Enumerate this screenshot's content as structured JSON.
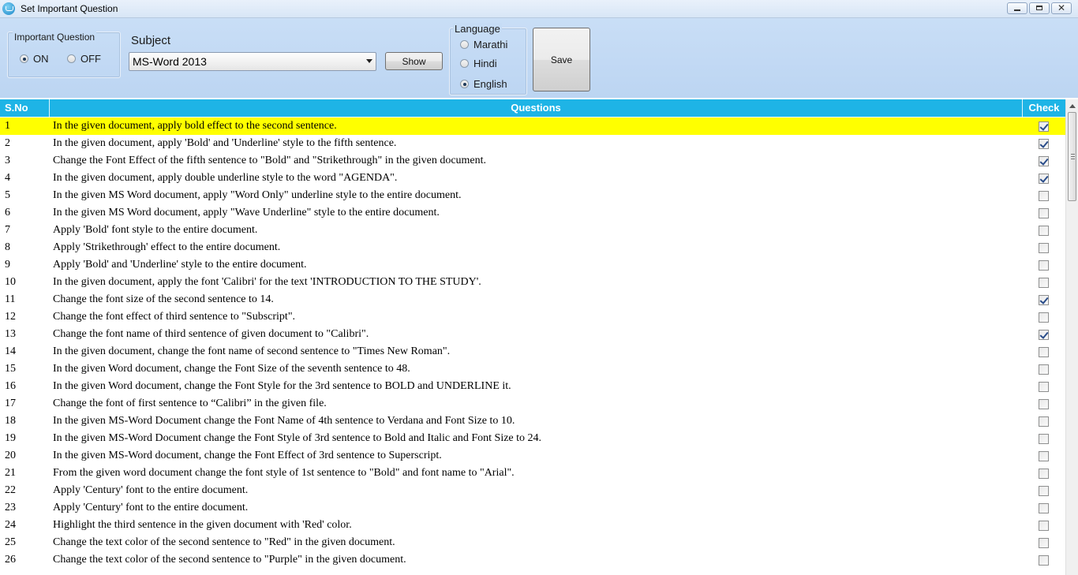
{
  "window": {
    "title": "Set Important Question"
  },
  "important_question": {
    "legend": "Important Question",
    "options": [
      {
        "label": "ON",
        "selected": true
      },
      {
        "label": "OFF",
        "selected": false
      }
    ]
  },
  "subject": {
    "label": "Subject",
    "selected": "MS-Word 2013"
  },
  "show_button": "Show",
  "language": {
    "legend": "Language",
    "options": [
      {
        "label": "Marathi",
        "selected": false
      },
      {
        "label": "Hindi",
        "selected": false
      },
      {
        "label": "English",
        "selected": true
      }
    ]
  },
  "save_button": "Save",
  "grid": {
    "columns": {
      "sno": "S.No",
      "questions": "Questions",
      "check": "Check"
    },
    "selected_row": 1,
    "rows": [
      {
        "sno": "1",
        "q": "In the given document, apply bold effect to the second sentence.",
        "checked": true
      },
      {
        "sno": "2",
        "q": "In the given document, apply 'Bold' and 'Underline' style to the fifth sentence.",
        "checked": true
      },
      {
        "sno": "3",
        "q": "Change the Font Effect of the fifth sentence to \"Bold\" and \"Strikethrough\" in the given document.",
        "checked": true
      },
      {
        "sno": "4",
        "q": "In the given document, apply double underline style to the word \"AGENDA\".",
        "checked": true
      },
      {
        "sno": "5",
        "q": "In the given MS Word document,  apply \"Word Only\" underline style to the entire document.",
        "checked": false
      },
      {
        "sno": "6",
        "q": "In the given MS Word document,  apply \"Wave Underline\" style to the entire document.",
        "checked": false
      },
      {
        "sno": "7",
        "q": "Apply 'Bold' font style to the entire document.",
        "checked": false
      },
      {
        "sno": "8",
        "q": "Apply 'Strikethrough' effect to the entire document.",
        "checked": false
      },
      {
        "sno": "9",
        "q": "Apply 'Bold' and 'Underline' style to the entire document.",
        "checked": false
      },
      {
        "sno": "10",
        "q": "In the given document, apply the font 'Calibri' for the text 'INTRODUCTION TO THE STUDY'.",
        "checked": false
      },
      {
        "sno": "11",
        "q": "Change the font size of the second sentence to 14.",
        "checked": true
      },
      {
        "sno": "12",
        "q": "Change the font effect of third sentence to \"Subscript\".",
        "checked": false
      },
      {
        "sno": "13",
        "q": "Change the font name of third sentence of given document to \"Calibri\".",
        "checked": true
      },
      {
        "sno": "14",
        "q": "In the given document, change the font name of second sentence to \"Times New Roman\".",
        "checked": false
      },
      {
        "sno": "15",
        "q": "In the given Word document, change the Font Size of the seventh sentence to 48.",
        "checked": false
      },
      {
        "sno": "16",
        "q": "In the given Word document, change the Font Style  for the 3rd sentence to BOLD  and  UNDERLINE it.",
        "checked": false
      },
      {
        "sno": "17",
        "q": "Change the font of first sentence to “Calibri” in the given file.",
        "checked": false
      },
      {
        "sno": "18",
        "q": "In the given MS-Word Document change the Font Name of 4th sentence to Verdana and Font Size to 10.",
        "checked": false
      },
      {
        "sno": "19",
        "q": "In the given MS-Word Document change the Font Style of 3rd sentence to Bold and Italic and Font Size to 24.",
        "checked": false
      },
      {
        "sno": "20",
        "q": "In the given MS-Word document, change the  Font Effect of 3rd sentence to Superscript.",
        "checked": false
      },
      {
        "sno": "21",
        "q": "From the given word  document change the font style of 1st sentence to \"Bold\" and font name to \"Arial\".",
        "checked": false
      },
      {
        "sno": "22",
        "q": "Apply 'Century' font to the entire document.",
        "checked": false
      },
      {
        "sno": "23",
        "q": "Apply 'Century' font to the entire document.",
        "checked": false
      },
      {
        "sno": "24",
        "q": "Highlight the third sentence in the given document with 'Red' color.",
        "checked": false
      },
      {
        "sno": "25",
        "q": "Change the text color of the second sentence to \"Red\" in the given  document.",
        "checked": false
      },
      {
        "sno": "26",
        "q": "Change the text color of the second sentence to \"Purple\" in the given document.",
        "checked": false
      }
    ]
  },
  "colors": {
    "header_bg": "#1eb4e6",
    "selected_row_bg": "#ffff00",
    "toolbar_bg": "#c6dcf5"
  }
}
